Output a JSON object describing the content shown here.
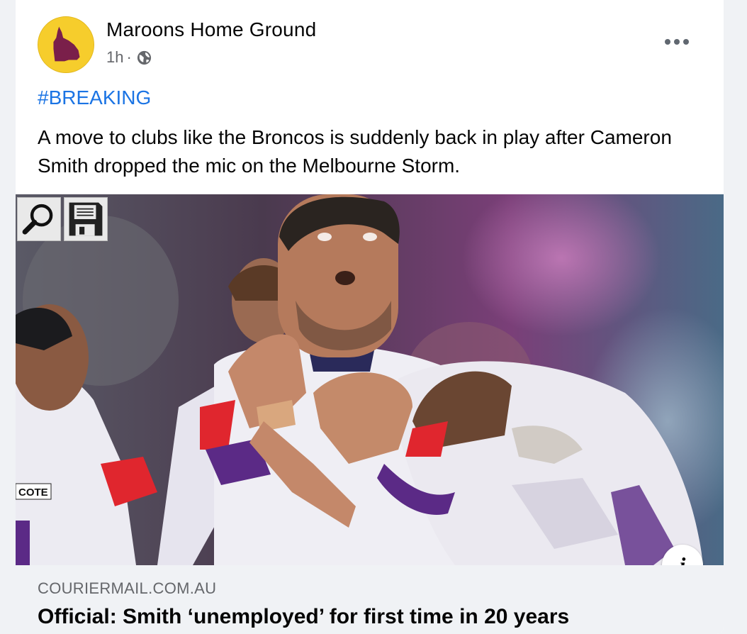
{
  "post": {
    "page_name": "Maroons Home Ground",
    "time": "1h",
    "separator": "·",
    "privacy_icon": "globe-icon",
    "more_icon": "more-options-icon",
    "hashtag": "#BREAKING",
    "text": "A move to clubs like the Broncos is suddenly back in play after Cameron Smith dropped the mic on the Melbourne Storm."
  },
  "image_overlay": {
    "zoom_tool_icon": "magnifier-icon",
    "save_tool_icon": "floppy-disk-icon",
    "info_icon": "info-icon",
    "info_label": "i",
    "jersey_text": "COTE"
  },
  "link_preview": {
    "domain": "COURIERMAIL.COM.AU",
    "headline": "Official: Smith ‘unemployed’ for first time in 20 years"
  },
  "colors": {
    "link_blue": "#1b74e4",
    "avatar_yellow": "#f6cd2c",
    "maroon": "#7a1f4a",
    "storm_purple": "#5b2a86",
    "text_primary": "#050505",
    "text_secondary": "#65676b"
  }
}
